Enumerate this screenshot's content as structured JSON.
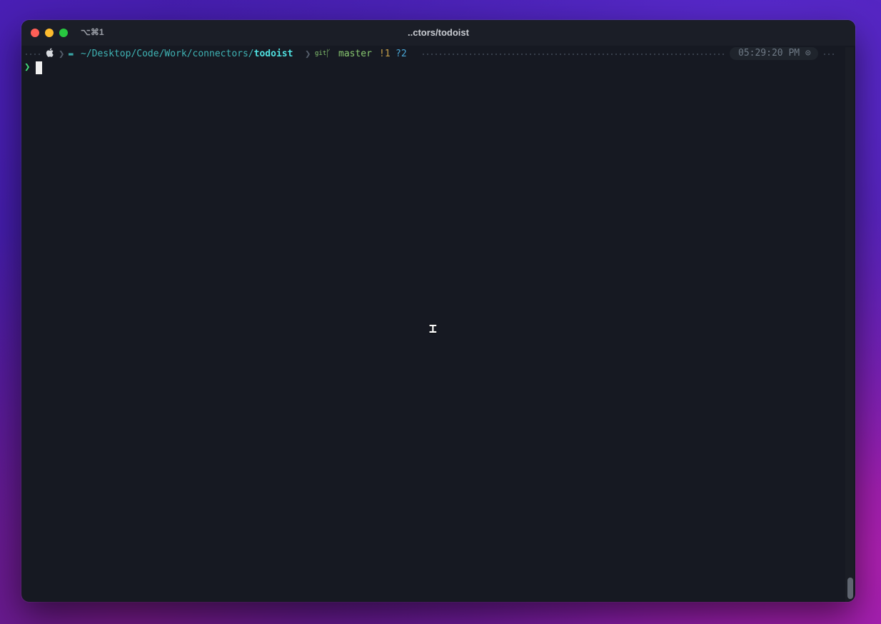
{
  "window": {
    "title": "..ctors/todoist",
    "shortcut": "⌥⌘1"
  },
  "prompt": {
    "apple_icon": "apple-icon",
    "separator": "❯",
    "folder_icon": "folder-icon",
    "path_prefix": "~/Desktop/Code/Work/connectors/",
    "path_current": "todoist",
    "git_label": "git",
    "branch_icon": "branch-icon",
    "branch": "master",
    "status_modified": "!1",
    "status_untracked": "?2",
    "time": "05:29:20 PM",
    "clock_icon": "clock-icon"
  },
  "input": {
    "prompt_char": "❯",
    "value": ""
  },
  "colors": {
    "background": "#161922",
    "path": "#3fb4b5",
    "branch": "#88c870",
    "prompt": "#43e07a"
  }
}
